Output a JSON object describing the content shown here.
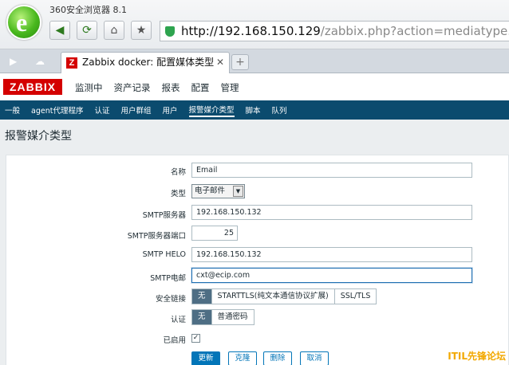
{
  "browser": {
    "app_title": "360安全浏览器 8.1",
    "logo_letter": "e",
    "url_host": "http://192.168.150.129",
    "url_path": "/zabbix.php?action=mediatype.edit&m",
    "icons": [
      "back-icon",
      "refresh-icon",
      "home-icon",
      "star-icon",
      "shield-icon"
    ]
  },
  "tab": {
    "title": "Zabbix docker: 配置媒体类型",
    "favicon_letter": "Z",
    "close": "✕",
    "new_tab": "+"
  },
  "zabbix": {
    "logo": "ZABBIX",
    "menu": [
      "监测中",
      "资产记录",
      "报表",
      "配置",
      "管理"
    ],
    "submenu": [
      "一般",
      "agent代理程序",
      "认证",
      "用户群组",
      "用户",
      "报警媒介类型",
      "脚本",
      "队列"
    ],
    "active_submenu": "报警媒介类型"
  },
  "page": {
    "title": "报警媒介类型"
  },
  "form": {
    "name_label": "名称",
    "name_value": "Email",
    "type_label": "类型",
    "type_value": "电子邮件",
    "smtp_server_label": "SMTP服务器",
    "smtp_server_value": "192.168.150.132",
    "smtp_port_label": "SMTP服务器端口",
    "smtp_port_value": "25",
    "smtp_helo_label": "SMTP HELO",
    "smtp_helo_value": "192.168.150.132",
    "smtp_email_label": "SMTP电邮",
    "smtp_email_value": "cxt@ecip.com",
    "security_label": "安全链接",
    "security_options": [
      "无",
      "STARTTLS(纯文本通信协议扩展)",
      "SSL/TLS"
    ],
    "auth_label": "认证",
    "auth_options": [
      "无",
      "普通密码"
    ],
    "enabled_label": "已启用",
    "enabled_mark": "✓",
    "buttons": {
      "update": "更新",
      "clone": "克隆",
      "delete": "删除",
      "cancel": "取消"
    }
  },
  "watermark": "ITIL先锋论坛",
  "colors": {
    "zabbix_red": "#d40000",
    "submenu_bg": "#0b4b6e",
    "primary_blue": "#0275b8"
  }
}
